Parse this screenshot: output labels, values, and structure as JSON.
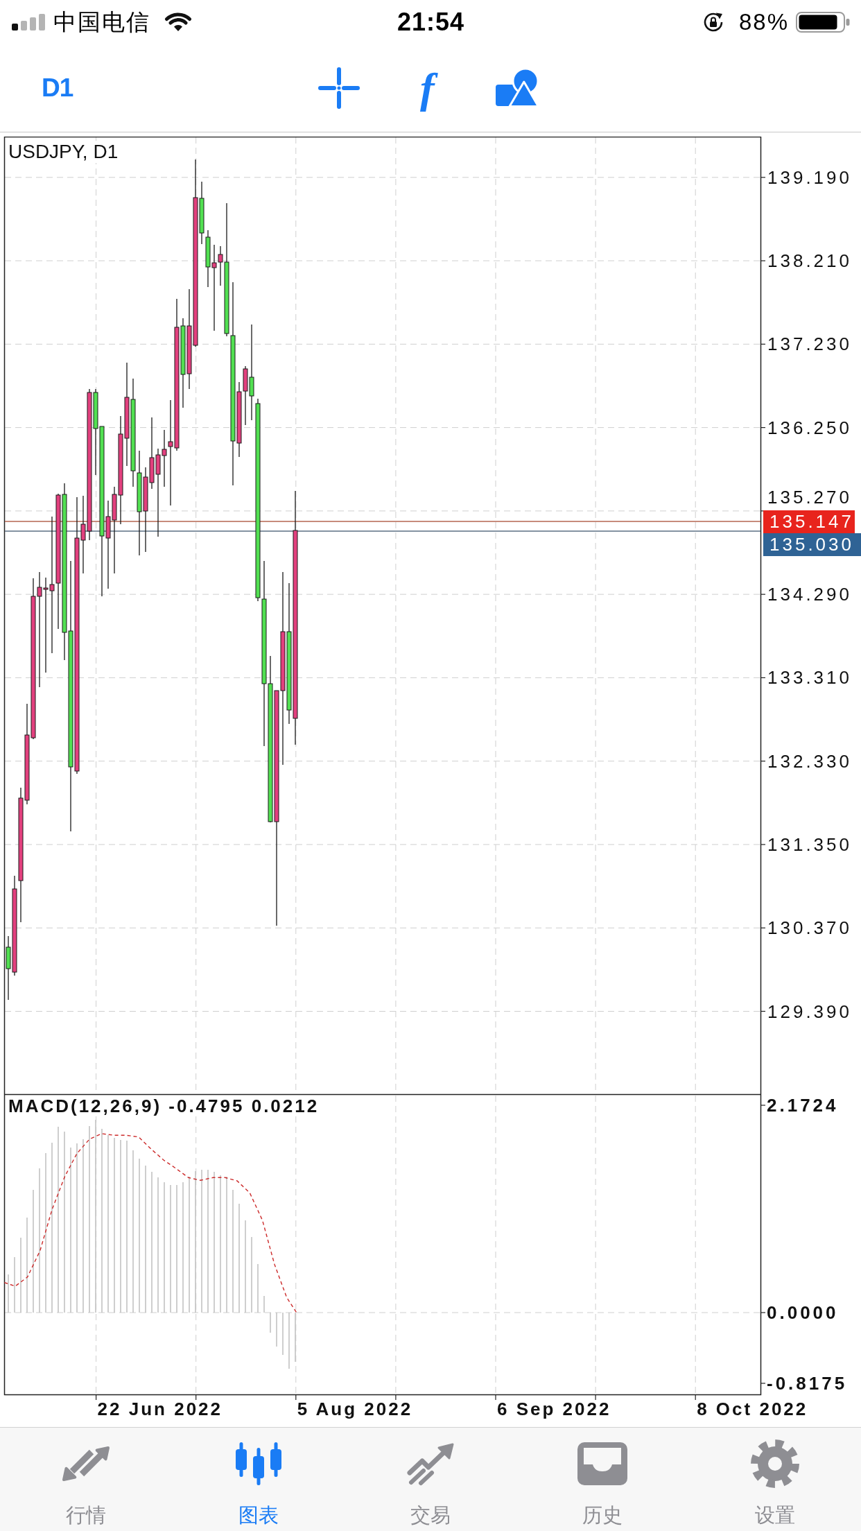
{
  "status_bar": {
    "carrier": "中国电信",
    "time": "21:54",
    "battery_percent": "88%"
  },
  "toolbar": {
    "timeframe": "D1",
    "indicators_button": "f"
  },
  "chart": {
    "title": "USDJPY, D1",
    "price_labels": [
      "139.190",
      "138.210",
      "137.230",
      "136.250",
      "135.270",
      "134.290",
      "133.310",
      "132.330",
      "131.350",
      "130.370",
      "129.390"
    ],
    "ask_price": "135.147",
    "bid_price": "135.030",
    "date_labels": [
      "22 Jun 2022",
      "5 Aug 2022",
      "6 Sep 2022",
      "8 Oct 2022"
    ]
  },
  "indicator": {
    "title": "MACD(12,26,9) -0.4795 0.0212",
    "scale_labels": [
      "2.1724",
      "0.0000",
      "-0.8175"
    ]
  },
  "tab_bar": {
    "tabs": [
      {
        "label": "行情",
        "selected": false
      },
      {
        "label": "图表",
        "selected": true
      },
      {
        "label": "交易",
        "selected": false
      },
      {
        "label": "历史",
        "selected": false
      },
      {
        "label": "设置",
        "selected": false
      }
    ]
  }
}
